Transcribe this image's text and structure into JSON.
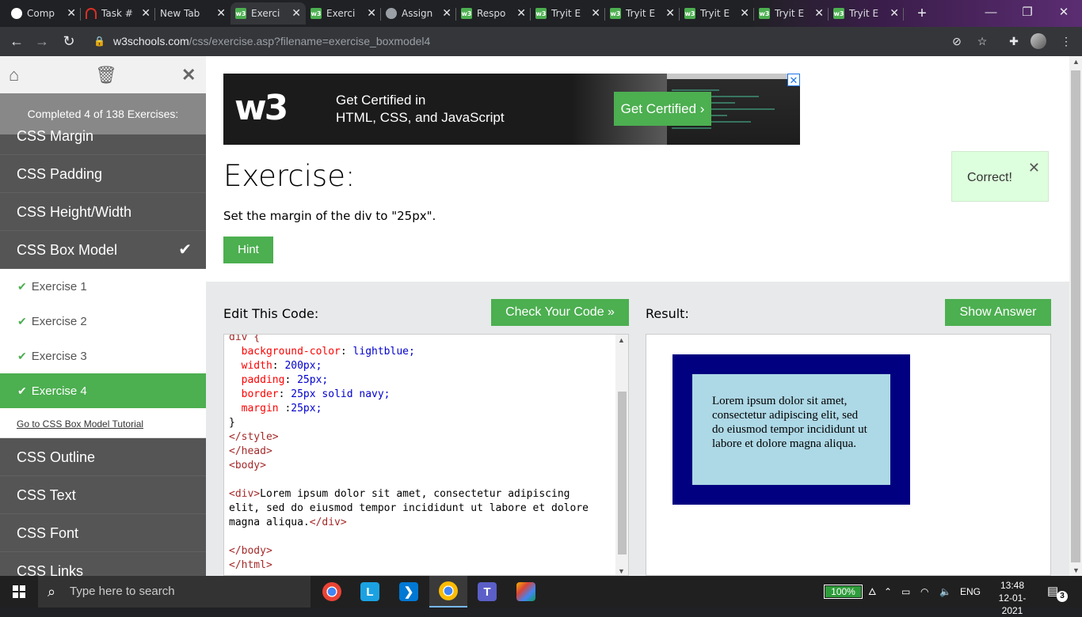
{
  "browser": {
    "tabs": [
      {
        "title": "Comp",
        "favicon": "github-icon",
        "color": "#ffffff"
      },
      {
        "title": "Task #",
        "favicon": "headset-icon",
        "color": "#d93025"
      },
      {
        "title": "New Tab",
        "favicon": "none",
        "color": "#202124"
      },
      {
        "title": "Exerci",
        "favicon": "w3-icon",
        "color": "#4caf50"
      },
      {
        "title": "Exerci",
        "favicon": "w3-icon",
        "color": "#4caf50"
      },
      {
        "title": "Assign",
        "favicon": "globe-icon",
        "color": "#9aa0a6"
      },
      {
        "title": "Respo",
        "favicon": "w3-icon",
        "color": "#4caf50"
      },
      {
        "title": "Tryit E",
        "favicon": "w3-icon",
        "color": "#4caf50"
      },
      {
        "title": "Tryit E",
        "favicon": "w3-icon",
        "color": "#4caf50"
      },
      {
        "title": "Tryit E",
        "favicon": "w3-icon",
        "color": "#4caf50"
      },
      {
        "title": "Tryit E",
        "favicon": "w3-icon",
        "color": "#4caf50"
      },
      {
        "title": "Tryit E",
        "favicon": "w3-icon",
        "color": "#4caf50"
      }
    ],
    "active_tab": 3,
    "url_host": "w3schools.com",
    "url_path": "/css/exercise.asp?filename=exercise_boxmodel4"
  },
  "sidebar": {
    "status": "Completed 4 of 138 Exercises:",
    "items_before": [
      "CSS Margin",
      "CSS Padding",
      "CSS Height/Width"
    ],
    "active_item": "CSS Box Model",
    "exercises": [
      "Exercise 1",
      "Exercise 2",
      "Exercise 3",
      "Exercise 4"
    ],
    "selected_exercise": 3,
    "tutorial_link": "Go to CSS Box Model Tutorial",
    "items_after": [
      "CSS Outline",
      "CSS Text",
      "CSS Font",
      "CSS Links"
    ]
  },
  "ad": {
    "logo": "w3",
    "line1": "Get Certified in",
    "line2": "HTML, CSS, and JavaScript",
    "cta": "Get Certified ›"
  },
  "exercise": {
    "title": "Exercise:",
    "description": "Set the margin of the div to \"25px\".",
    "hint_label": "Hint",
    "feedback": "Correct!"
  },
  "editor": {
    "label": "Edit This Code:",
    "check_label": "Check Your Code »",
    "code_lines": [
      [
        {
          "t": "div {",
          "c": "tag"
        }
      ],
      [
        {
          "t": "  "
        },
        {
          "t": "background-color",
          "c": "prop"
        },
        {
          "t": ": "
        },
        {
          "t": "lightblue;",
          "c": "val"
        }
      ],
      [
        {
          "t": "  "
        },
        {
          "t": "width",
          "c": "prop"
        },
        {
          "t": ": "
        },
        {
          "t": "200px;",
          "c": "val"
        }
      ],
      [
        {
          "t": "  "
        },
        {
          "t": "padding",
          "c": "prop"
        },
        {
          "t": ": "
        },
        {
          "t": "25px;",
          "c": "val"
        }
      ],
      [
        {
          "t": "  "
        },
        {
          "t": "border",
          "c": "prop"
        },
        {
          "t": ": "
        },
        {
          "t": "25px solid navy;",
          "c": "val"
        }
      ],
      [
        {
          "t": "  "
        },
        {
          "t": "margin",
          "c": "prop"
        },
        {
          "t": " :"
        },
        {
          "t": "25px;",
          "c": "val"
        }
      ],
      [
        {
          "t": "}"
        }
      ],
      [
        {
          "t": "</style>",
          "c": "tag"
        }
      ],
      [
        {
          "t": "</head>",
          "c": "tag"
        }
      ],
      [
        {
          "t": "<body>",
          "c": "tag"
        }
      ],
      [
        {
          "t": ""
        }
      ],
      [
        {
          "t": "<div>",
          "c": "tag"
        },
        {
          "t": "Lorem ipsum dolor sit amet, consectetur adipiscing"
        }
      ],
      [
        {
          "t": "elit, sed do eiusmod tempor incididunt ut labore et dolore"
        }
      ],
      [
        {
          "t": "magna aliqua."
        },
        {
          "t": "</div>",
          "c": "tag"
        }
      ],
      [
        {
          "t": ""
        }
      ],
      [
        {
          "t": "</body>",
          "c": "tag"
        }
      ],
      [
        {
          "t": "</html>",
          "c": "tag"
        }
      ]
    ]
  },
  "result": {
    "label": "Result:",
    "answer_label": "Show Answer",
    "text": "Lorem ipsum dolor sit amet, consectetur adipiscing elit, sed do eiusmod tempor incididunt ut labore et dolore magna aliqua."
  },
  "taskbar": {
    "search_placeholder": "Type here to search",
    "battery": "100%",
    "language": "ENG",
    "time": "13:48",
    "date": "12-01-2021",
    "notifications": "3"
  }
}
